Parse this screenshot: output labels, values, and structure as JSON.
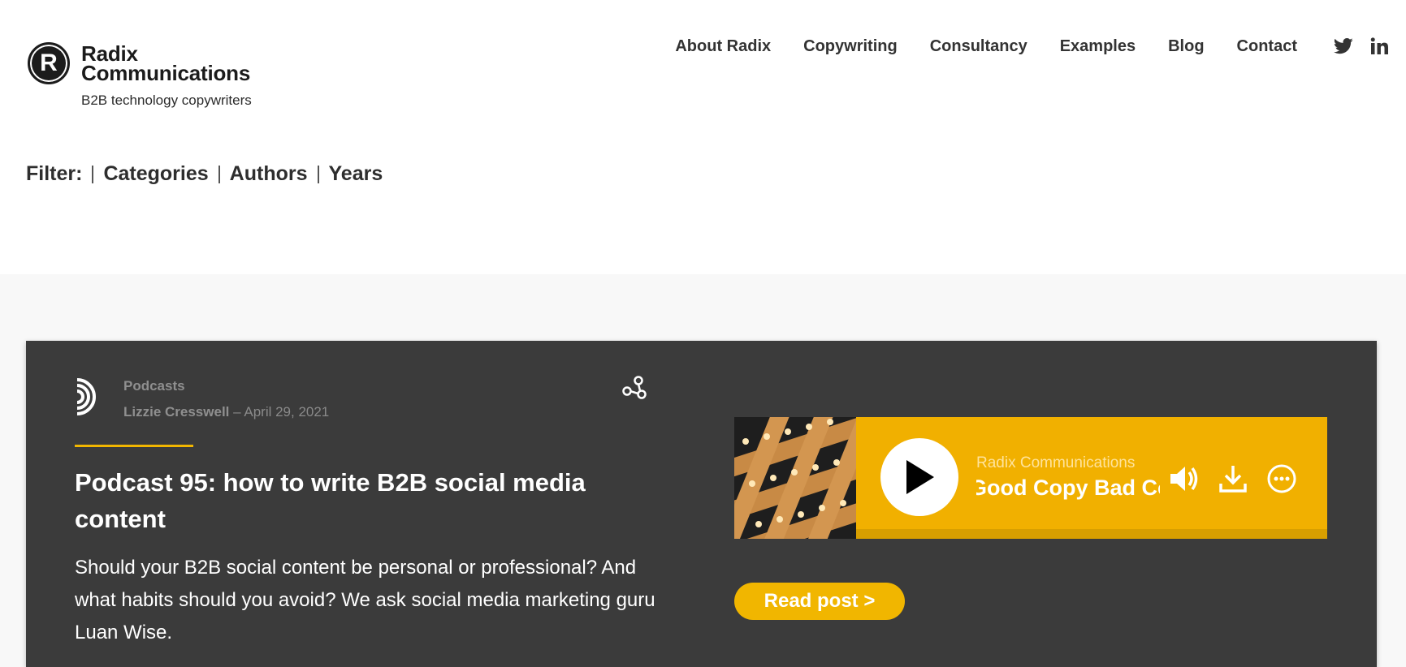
{
  "brand": {
    "logo_letter": "R",
    "name_line1": "Radix",
    "name_line2": "Communications",
    "tagline": "B2B technology copywriters"
  },
  "nav": {
    "items": [
      "About Radix",
      "Copywriting",
      "Consultancy",
      "Examples",
      "Blog",
      "Contact"
    ],
    "social": [
      "twitter-icon",
      "linkedin-icon"
    ]
  },
  "filter": {
    "label": "Filter:",
    "options": [
      "Categories",
      "Authors",
      "Years"
    ]
  },
  "post": {
    "category": "Podcasts",
    "author": "Lizzie Cresswell",
    "date_sep": " – ",
    "date": "April 29, 2021",
    "title": "Podcast 95: how to write B2B social media content",
    "excerpt": "Should your B2B social content be personal or professional? And what habits should you avoid? We ask social media marketing guru Luan Wise.",
    "read_label": "Read post >"
  },
  "player": {
    "publisher": "Radix Communications",
    "show_title": "Good Copy Bad Copy",
    "controls": [
      "play-icon",
      "volume-icon",
      "download-icon",
      "more-icon"
    ]
  },
  "colors": {
    "accent": "#f1b600",
    "card_bg": "#3b3b3b",
    "band_bg": "#f8f8f8"
  }
}
